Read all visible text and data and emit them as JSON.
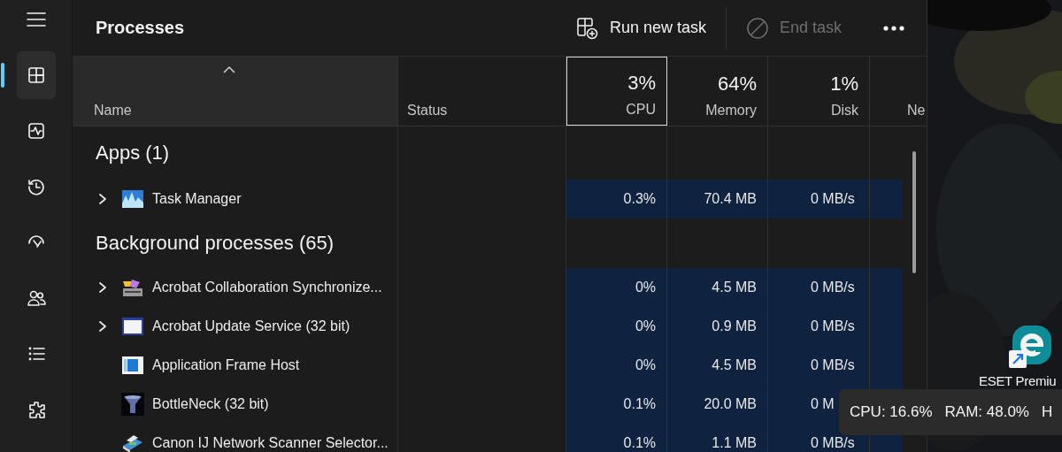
{
  "sidebar": {
    "nav_items": [
      {
        "kind": "processes",
        "selected": true
      },
      {
        "kind": "performance",
        "selected": false
      },
      {
        "kind": "history",
        "selected": false
      },
      {
        "kind": "startup",
        "selected": false
      },
      {
        "kind": "users",
        "selected": false
      },
      {
        "kind": "details",
        "selected": false
      },
      {
        "kind": "services",
        "selected": false
      }
    ]
  },
  "header": {
    "title": "Processes",
    "commands": [
      {
        "kind": "run",
        "label": "Run new task",
        "disabled": false
      },
      {
        "kind": "end",
        "label": "End task",
        "disabled": true
      }
    ]
  },
  "table": {
    "columns": [
      {
        "label": "Name",
        "sorted": true,
        "selected": false
      },
      {
        "label": "Status",
        "sorted": false,
        "selected": false
      },
      {
        "label": "CPU",
        "usage": "3%",
        "sorted": false,
        "selected": true
      },
      {
        "label": "Memory",
        "usage": "64%",
        "sorted": false,
        "selected": false
      },
      {
        "label": "Disk",
        "usage": "1%",
        "sorted": false,
        "selected": false
      },
      {
        "label": "Ne",
        "sorted": false,
        "selected": false
      }
    ],
    "groups": [
      {
        "title": "Apps (1)",
        "rows": [
          {
            "name": "Task Manager",
            "kind": "monitor",
            "expandable": true,
            "cpu": "0.3%",
            "memory": "70.4 MB",
            "disk": "0 MB/s"
          }
        ]
      },
      {
        "title": "Background processes (65)",
        "rows": [
          {
            "name": "Acrobat Collaboration Synchronize...",
            "kind": "sync",
            "expandable": true,
            "cpu": "0%",
            "memory": "4.5 MB",
            "disk": "0 MB/s"
          },
          {
            "name": "Acrobat Update Service (32 bit)",
            "kind": "window",
            "expandable": true,
            "cpu": "0%",
            "memory": "0.9 MB",
            "disk": "0 MB/s"
          },
          {
            "name": "Application Frame Host",
            "kind": "frame",
            "expandable": false,
            "cpu": "0%",
            "memory": "4.5 MB",
            "disk": "0 MB/s"
          },
          {
            "name": "BottleNeck (32 bit)",
            "kind": "funnel",
            "expandable": false,
            "cpu": "0.1%",
            "memory": "20.0 MB",
            "disk": "0 M"
          },
          {
            "name": "Canon IJ Network Scanner Selector...",
            "kind": "scanner",
            "expandable": false,
            "cpu": "0.1%",
            "memory": "1.1 MB",
            "disk": "0 MB/s"
          }
        ]
      }
    ]
  },
  "desktop": {
    "shortcut_label": "ESET Premiu"
  },
  "tooltip": {
    "items": [
      "CPU: 16.6%",
      "RAM: 48.0%",
      "H"
    ]
  }
}
